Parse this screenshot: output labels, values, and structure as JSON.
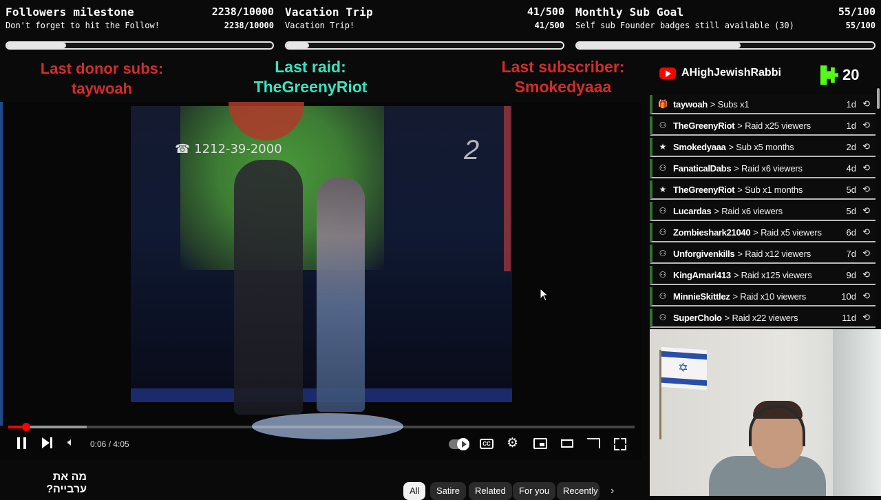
{
  "goals": [
    {
      "title": "Followers milestone",
      "count": "2238/10000",
      "subtitle": "Don't forget to hit the Follow!",
      "subcount": "2238/10000",
      "progress": 0.2238
    },
    {
      "title": "Vacation Trip",
      "count": "41/500",
      "subtitle": "Vacation Trip!",
      "subcount": "41/500",
      "progress": 0.082
    },
    {
      "title": "Monthly Sub Goal",
      "count": "55/100",
      "subtitle": "Self sub Founder badges still available (30)",
      "subcount": "55/100",
      "progress": 0.55
    }
  ],
  "alerts": {
    "donor_label": "Last donor subs:",
    "donor_name": "taywoah",
    "raid_label": "Last raid:",
    "raid_name": "TheGreenyRiot",
    "sub_label": "Last subscriber:",
    "sub_name": "Smokedyaaa"
  },
  "colors": {
    "donor": "#d62b2b",
    "raid": "#35e6c3",
    "sub": "#d62b2b",
    "youtube": "#ff0000",
    "kick": "#53fc18"
  },
  "channel": {
    "youtube_name": "AHighJewishRabbi",
    "kick_count": "20"
  },
  "events": [
    {
      "icon": "gift-icon",
      "name": "taywoah",
      "action": "> Subs x1",
      "time": "1d"
    },
    {
      "icon": "raid-icon",
      "name": "TheGreenyRiot",
      "action": "> Raid x25 viewers",
      "time": "1d"
    },
    {
      "icon": "star-icon",
      "name": "Smokedyaaa",
      "action": "> Sub x5 months",
      "time": "2d"
    },
    {
      "icon": "raid-icon",
      "name": "FanaticalDabs",
      "action": "> Raid x6 viewers",
      "time": "4d"
    },
    {
      "icon": "star-icon",
      "name": "TheGreenyRiot",
      "action": "> Sub x1 months",
      "time": "5d"
    },
    {
      "icon": "raid-icon",
      "name": "Lucardas",
      "action": "> Raid x6 viewers",
      "time": "5d"
    },
    {
      "icon": "raid-icon",
      "name": "Zombieshark21040",
      "action": "> Raid x5 viewers",
      "time": "6d"
    },
    {
      "icon": "raid-icon",
      "name": "Unforgivenkills",
      "action": "> Raid x12 viewers",
      "time": "7d"
    },
    {
      "icon": "raid-icon",
      "name": "KingAmari413",
      "action": "> Raid x125 viewers",
      "time": "9d"
    },
    {
      "icon": "raid-icon",
      "name": "MinnieSkittlez",
      "action": "> Raid x10 viewers",
      "time": "10d"
    },
    {
      "icon": "raid-icon",
      "name": "SuperCholo",
      "action": "> Raid x22 viewers",
      "time": "11d"
    }
  ],
  "video": {
    "overlay_phone": "☎ 1212-39-2000",
    "channel_logo": "2",
    "time_display": "0:06 / 4:05",
    "progress": 0.024,
    "title": "מה את ערבייה?"
  },
  "chips": [
    "All",
    "Satire",
    "Related",
    "For you",
    "Recently"
  ]
}
